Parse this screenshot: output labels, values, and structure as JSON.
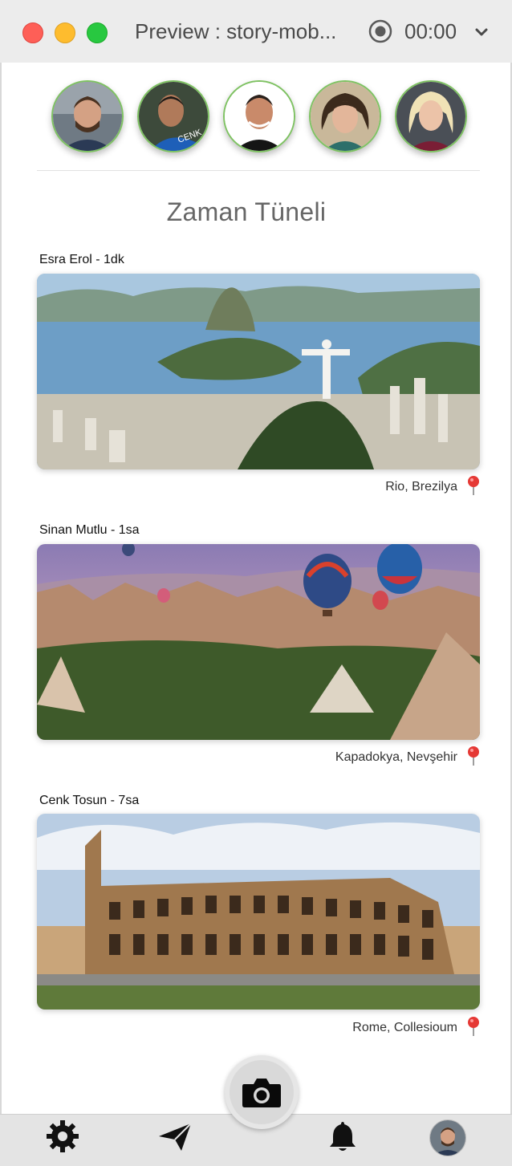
{
  "window": {
    "title": "Preview : story-mob...",
    "timer": "00:00",
    "icons": [
      "close-icon",
      "minimize-icon",
      "zoom-icon",
      "record-icon",
      "chevron-down-icon"
    ]
  },
  "stories": [
    {
      "avatar": "avatar-1"
    },
    {
      "avatar": "avatar-2"
    },
    {
      "avatar": "avatar-3"
    },
    {
      "avatar": "avatar-4"
    },
    {
      "avatar": "avatar-5"
    }
  ],
  "page_title": "Zaman Tüneli",
  "posts": [
    {
      "author": "Esra Erol - 1dk",
      "location": "Rio, Brezilya",
      "image": "rio-photo"
    },
    {
      "author": "Sinan Mutlu - 1sa",
      "location": "Kapadokya, Nevşehir",
      "image": "cappadocia-photo"
    },
    {
      "author": "Cenk Tosun - 7sa",
      "location": "Rome, Collesioum",
      "image": "colosseum-photo"
    }
  ],
  "tabbar": {
    "icons": [
      "gear-icon",
      "send-icon",
      "camera-icon",
      "bell-icon",
      "profile-avatar"
    ]
  },
  "colors": {
    "accent_ring": "#7fc263",
    "pin": "#e53935",
    "tabbar": "#e4e4e4"
  }
}
